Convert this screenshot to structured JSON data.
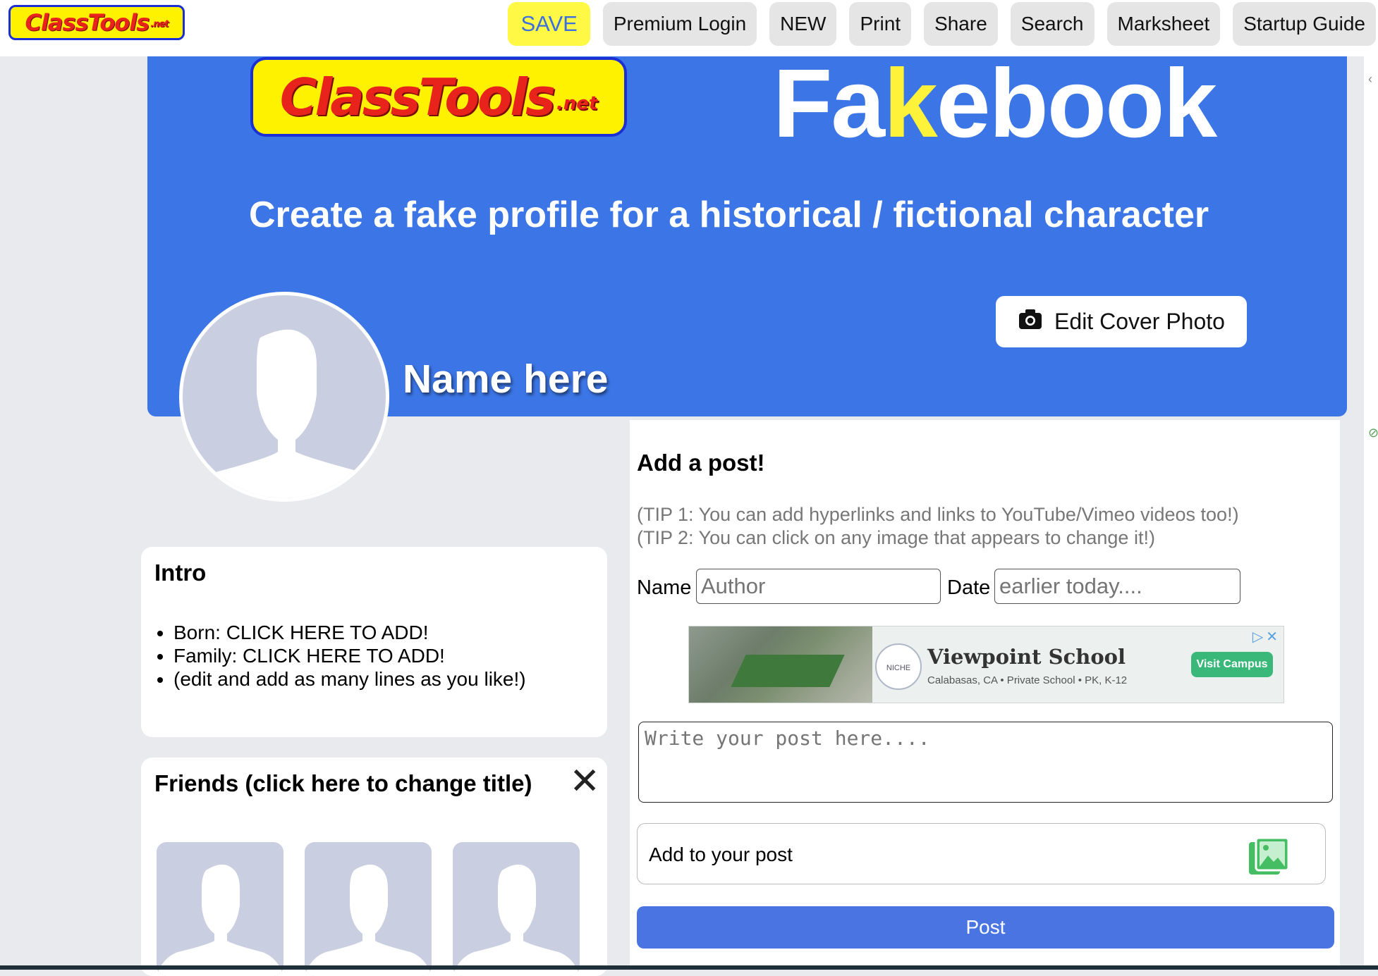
{
  "topbar": {
    "logo_text": "ClassTools",
    "logo_suffix": ".net",
    "nav": [
      "SAVE",
      "Premium Login",
      "NEW",
      "Print",
      "Share",
      "Search",
      "Marksheet",
      "Startup Guide"
    ]
  },
  "cover": {
    "logo_text": "ClassTools",
    "logo_suffix": ".net",
    "title_pre": "Fa",
    "title_k": "k",
    "title_post": "ebook",
    "tagline": "Create a fake profile for a historical / fictional character",
    "edit_cover_label": "Edit Cover Photo",
    "profile_name": "Name here"
  },
  "intro": {
    "title": "Intro",
    "items": [
      "Born: CLICK HERE TO ADD!",
      "Family: CLICK HERE TO ADD!",
      "(edit and add as many lines as you like!)"
    ]
  },
  "friends": {
    "title": "Friends (click here to change title)",
    "close_symbol": "✕"
  },
  "post": {
    "heading": "Add a post!",
    "tip1": "(TIP 1: You can add hyperlinks and links to YouTube/Vimeo videos too!)",
    "tip2": "(TIP 2: You can click on any image that appears to change it!)",
    "name_label": "Name",
    "name_placeholder": "Author",
    "date_label": "Date",
    "date_placeholder": "earlier today....",
    "textarea_placeholder": "Write your post here....",
    "add_to_post_label": "Add to your post",
    "post_button": "Post"
  },
  "ad": {
    "badge_text": "NICHE",
    "name": "Viewpoint School",
    "sub": "Calabasas, CA  •  Private School  •  PK, K-12",
    "cta": "Visit Campus"
  },
  "colors": {
    "cover_blue": "#3c76e6",
    "save_yellow": "#fff845",
    "post_button_blue": "#4a74e1",
    "fakebook_k_yellow": "#fff23a"
  }
}
